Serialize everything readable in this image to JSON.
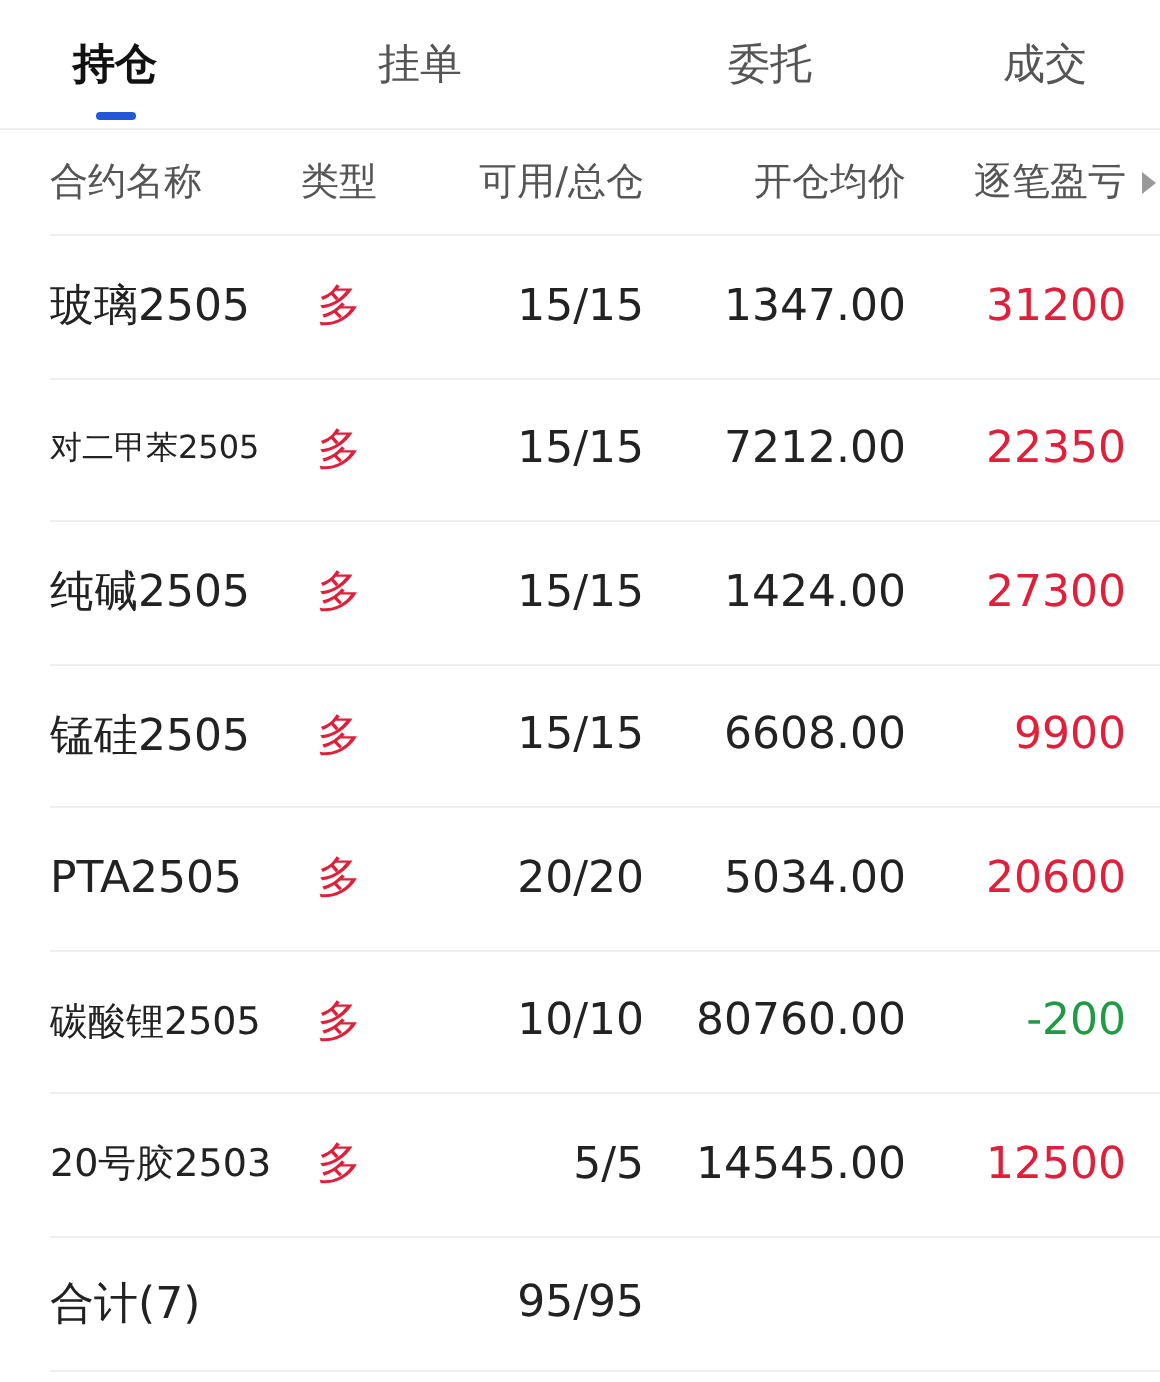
{
  "tabs": [
    {
      "label": "持仓",
      "selected": true
    },
    {
      "label": "挂单",
      "selected": false
    },
    {
      "label": "委托",
      "selected": false
    },
    {
      "label": "成交",
      "selected": false
    }
  ],
  "table": {
    "columns": [
      "合约名称",
      "类型",
      "可用/总仓",
      "开仓均价",
      "逐笔盈亏"
    ],
    "rows": [
      {
        "name": "玻璃2505",
        "type": "多",
        "available": "15/15",
        "avg_price": "1347.00",
        "pnl": "31200",
        "color": "#e0203a"
      },
      {
        "name": "对二甲苯2505",
        "type": "多",
        "available": "15/15",
        "avg_price": "7212.00",
        "pnl": "22350",
        "color": "#e0203a"
      },
      {
        "name": "纯碱2505",
        "type": "多",
        "available": "15/15",
        "avg_price": "1424.00",
        "pnl": "27300",
        "color": "#e0203a"
      },
      {
        "name": "锰硅2505",
        "type": "多",
        "available": "15/15",
        "avg_price": "6608.00",
        "pnl": "9900",
        "color": "#e0203a"
      },
      {
        "name": "PTA2505",
        "type": "多",
        "available": "20/20",
        "avg_price": "5034.00",
        "pnl": "20600",
        "color": "#e0203a"
      },
      {
        "name": "碳酸锂2505",
        "type": "多",
        "available": "10/10",
        "avg_price": "80760.00",
        "pnl": "-200",
        "color": "#1f9a45"
      },
      {
        "name": "20号胶2503",
        "type": "多",
        "available": "5/5",
        "avg_price": "14545.00",
        "pnl": "12500",
        "color": "#e0203a"
      }
    ],
    "total": {
      "label": "合计(7)",
      "available": "95/95"
    }
  }
}
